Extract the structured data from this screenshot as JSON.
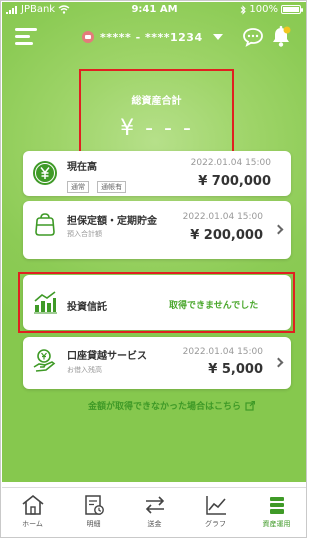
{
  "status_bar": {
    "carrier": "JPBank",
    "time": "9:41 AM",
    "battery": "100%"
  },
  "header": {
    "account_masked": "***** - ****1234"
  },
  "total": {
    "label": "総資産合計",
    "value": "¥ - - -"
  },
  "cards": [
    {
      "title": "現在高",
      "tags": [
        "通常",
        "通帳有"
      ],
      "date": "2022.01.04 15:00",
      "amount": "¥ 700,000"
    },
    {
      "title": "担保定額・定期貯金",
      "subtitle": "預入合計額",
      "date": "2022.01.04 15:00",
      "amount": "¥ 200,000"
    },
    {
      "title": "投資信託",
      "status": "取得できませんでした"
    },
    {
      "title": "口座貸越サービス",
      "subtitle": "お借入残高",
      "date": "2022.01.04 15:00",
      "amount": "¥ 5,000"
    }
  ],
  "help_link": "金額が取得できなかった場合はこちら",
  "bottom_nav": [
    {
      "label": "ホーム",
      "icon": "home-icon"
    },
    {
      "label": "明細",
      "icon": "statement-icon"
    },
    {
      "label": "送金",
      "icon": "transfer-icon"
    },
    {
      "label": "グラフ",
      "icon": "graph-icon"
    },
    {
      "label": "資産運用",
      "icon": "assets-icon",
      "active": true
    }
  ],
  "colors": {
    "primary_green": "#8ccb55",
    "accent_green": "#3f9a27",
    "highlight_red": "#e02020"
  }
}
